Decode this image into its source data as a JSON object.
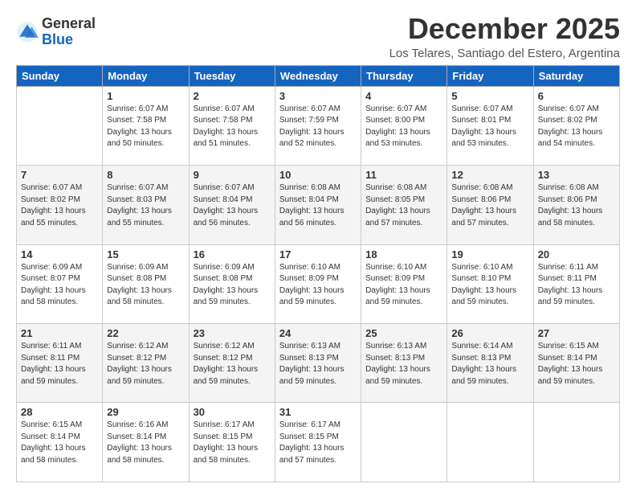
{
  "header": {
    "logo_general": "General",
    "logo_blue": "Blue",
    "title": "December 2025",
    "subtitle": "Los Telares, Santiago del Estero, Argentina"
  },
  "days_header": [
    "Sunday",
    "Monday",
    "Tuesday",
    "Wednesday",
    "Thursday",
    "Friday",
    "Saturday"
  ],
  "weeks": [
    [
      {
        "day": "",
        "info": ""
      },
      {
        "day": "1",
        "info": "Sunrise: 6:07 AM\nSunset: 7:58 PM\nDaylight: 13 hours\nand 50 minutes."
      },
      {
        "day": "2",
        "info": "Sunrise: 6:07 AM\nSunset: 7:58 PM\nDaylight: 13 hours\nand 51 minutes."
      },
      {
        "day": "3",
        "info": "Sunrise: 6:07 AM\nSunset: 7:59 PM\nDaylight: 13 hours\nand 52 minutes."
      },
      {
        "day": "4",
        "info": "Sunrise: 6:07 AM\nSunset: 8:00 PM\nDaylight: 13 hours\nand 53 minutes."
      },
      {
        "day": "5",
        "info": "Sunrise: 6:07 AM\nSunset: 8:01 PM\nDaylight: 13 hours\nand 53 minutes."
      },
      {
        "day": "6",
        "info": "Sunrise: 6:07 AM\nSunset: 8:02 PM\nDaylight: 13 hours\nand 54 minutes."
      }
    ],
    [
      {
        "day": "7",
        "info": "Sunrise: 6:07 AM\nSunset: 8:02 PM\nDaylight: 13 hours\nand 55 minutes."
      },
      {
        "day": "8",
        "info": "Sunrise: 6:07 AM\nSunset: 8:03 PM\nDaylight: 13 hours\nand 55 minutes."
      },
      {
        "day": "9",
        "info": "Sunrise: 6:07 AM\nSunset: 8:04 PM\nDaylight: 13 hours\nand 56 minutes."
      },
      {
        "day": "10",
        "info": "Sunrise: 6:08 AM\nSunset: 8:04 PM\nDaylight: 13 hours\nand 56 minutes."
      },
      {
        "day": "11",
        "info": "Sunrise: 6:08 AM\nSunset: 8:05 PM\nDaylight: 13 hours\nand 57 minutes."
      },
      {
        "day": "12",
        "info": "Sunrise: 6:08 AM\nSunset: 8:06 PM\nDaylight: 13 hours\nand 57 minutes."
      },
      {
        "day": "13",
        "info": "Sunrise: 6:08 AM\nSunset: 8:06 PM\nDaylight: 13 hours\nand 58 minutes."
      }
    ],
    [
      {
        "day": "14",
        "info": "Sunrise: 6:09 AM\nSunset: 8:07 PM\nDaylight: 13 hours\nand 58 minutes."
      },
      {
        "day": "15",
        "info": "Sunrise: 6:09 AM\nSunset: 8:08 PM\nDaylight: 13 hours\nand 58 minutes."
      },
      {
        "day": "16",
        "info": "Sunrise: 6:09 AM\nSunset: 8:08 PM\nDaylight: 13 hours\nand 59 minutes."
      },
      {
        "day": "17",
        "info": "Sunrise: 6:10 AM\nSunset: 8:09 PM\nDaylight: 13 hours\nand 59 minutes."
      },
      {
        "day": "18",
        "info": "Sunrise: 6:10 AM\nSunset: 8:09 PM\nDaylight: 13 hours\nand 59 minutes."
      },
      {
        "day": "19",
        "info": "Sunrise: 6:10 AM\nSunset: 8:10 PM\nDaylight: 13 hours\nand 59 minutes."
      },
      {
        "day": "20",
        "info": "Sunrise: 6:11 AM\nSunset: 8:11 PM\nDaylight: 13 hours\nand 59 minutes."
      }
    ],
    [
      {
        "day": "21",
        "info": "Sunrise: 6:11 AM\nSunset: 8:11 PM\nDaylight: 13 hours\nand 59 minutes."
      },
      {
        "day": "22",
        "info": "Sunrise: 6:12 AM\nSunset: 8:12 PM\nDaylight: 13 hours\nand 59 minutes."
      },
      {
        "day": "23",
        "info": "Sunrise: 6:12 AM\nSunset: 8:12 PM\nDaylight: 13 hours\nand 59 minutes."
      },
      {
        "day": "24",
        "info": "Sunrise: 6:13 AM\nSunset: 8:13 PM\nDaylight: 13 hours\nand 59 minutes."
      },
      {
        "day": "25",
        "info": "Sunrise: 6:13 AM\nSunset: 8:13 PM\nDaylight: 13 hours\nand 59 minutes."
      },
      {
        "day": "26",
        "info": "Sunrise: 6:14 AM\nSunset: 8:13 PM\nDaylight: 13 hours\nand 59 minutes."
      },
      {
        "day": "27",
        "info": "Sunrise: 6:15 AM\nSunset: 8:14 PM\nDaylight: 13 hours\nand 59 minutes."
      }
    ],
    [
      {
        "day": "28",
        "info": "Sunrise: 6:15 AM\nSunset: 8:14 PM\nDaylight: 13 hours\nand 58 minutes."
      },
      {
        "day": "29",
        "info": "Sunrise: 6:16 AM\nSunset: 8:14 PM\nDaylight: 13 hours\nand 58 minutes."
      },
      {
        "day": "30",
        "info": "Sunrise: 6:17 AM\nSunset: 8:15 PM\nDaylight: 13 hours\nand 58 minutes."
      },
      {
        "day": "31",
        "info": "Sunrise: 6:17 AM\nSunset: 8:15 PM\nDaylight: 13 hours\nand 57 minutes."
      },
      {
        "day": "",
        "info": ""
      },
      {
        "day": "",
        "info": ""
      },
      {
        "day": "",
        "info": ""
      }
    ]
  ]
}
